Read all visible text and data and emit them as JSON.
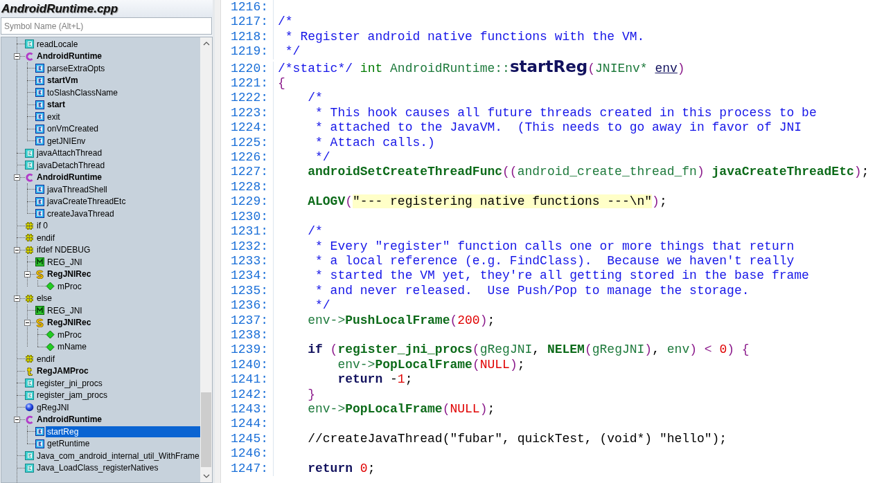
{
  "file_title": "AndroidRuntime.cpp",
  "symbol_search": {
    "placeholder": "Symbol Name (Alt+L)"
  },
  "symbol_tree": [
    {
      "label": "readLocale",
      "kind": "function",
      "bold": false,
      "selected": false
    },
    {
      "label": "AndroidRuntime",
      "kind": "class",
      "bold": true,
      "selected": false,
      "expanded": true,
      "children": [
        {
          "label": "parseExtraOpts",
          "kind": "method",
          "bold": false,
          "selected": false
        },
        {
          "label": "startVm",
          "kind": "method",
          "bold": true,
          "selected": false
        },
        {
          "label": "toSlashClassName",
          "kind": "method",
          "bold": false,
          "selected": false
        },
        {
          "label": "start",
          "kind": "method",
          "bold": true,
          "selected": false
        },
        {
          "label": "exit",
          "kind": "method",
          "bold": false,
          "selected": false
        },
        {
          "label": "onVmCreated",
          "kind": "method",
          "bold": false,
          "selected": false
        },
        {
          "label": "getJNIEnv",
          "kind": "method",
          "bold": false,
          "selected": false
        }
      ]
    },
    {
      "label": "javaAttachThread",
      "kind": "function",
      "bold": false,
      "selected": false
    },
    {
      "label": "javaDetachThread",
      "kind": "function",
      "bold": false,
      "selected": false
    },
    {
      "label": "AndroidRuntime",
      "kind": "class",
      "bold": true,
      "selected": false,
      "expanded": true,
      "children": [
        {
          "label": "javaThreadShell",
          "kind": "method",
          "bold": false,
          "selected": false
        },
        {
          "label": "javaCreateThreadEtc",
          "kind": "method",
          "bold": false,
          "selected": false
        },
        {
          "label": "createJavaThread",
          "kind": "method",
          "bold": false,
          "selected": false
        }
      ]
    },
    {
      "label": "if 0",
      "kind": "preprocessor",
      "bold": false,
      "selected": false
    },
    {
      "label": "endif",
      "kind": "preprocessor",
      "bold": false,
      "selected": false
    },
    {
      "label": "ifdef NDEBUG",
      "kind": "preprocessor",
      "bold": false,
      "selected": false,
      "expanded": true,
      "children": [
        {
          "label": "REG_JNI",
          "kind": "macro",
          "bold": false,
          "selected": false
        },
        {
          "label": "RegJNIRec",
          "kind": "struct",
          "bold": true,
          "selected": false,
          "expanded": true,
          "children": [
            {
              "label": "mProc",
              "kind": "member",
              "bold": false,
              "selected": false
            }
          ]
        }
      ]
    },
    {
      "label": "else",
      "kind": "preprocessor",
      "bold": false,
      "selected": false,
      "expanded": true,
      "children": [
        {
          "label": "REG_JNI",
          "kind": "macro",
          "bold": false,
          "selected": false
        },
        {
          "label": "RegJNIRec",
          "kind": "struct",
          "bold": true,
          "selected": false,
          "expanded": true,
          "children": [
            {
              "label": "mProc",
              "kind": "member",
              "bold": false,
              "selected": false
            },
            {
              "label": "mName",
              "kind": "member",
              "bold": false,
              "selected": false
            }
          ]
        }
      ]
    },
    {
      "label": "endif",
      "kind": "preprocessor",
      "bold": false,
      "selected": false
    },
    {
      "label": "RegJAMProc",
      "kind": "typedef",
      "bold": true,
      "selected": false
    },
    {
      "label": "register_jni_procs",
      "kind": "function",
      "bold": false,
      "selected": false
    },
    {
      "label": "register_jam_procs",
      "kind": "function",
      "bold": false,
      "selected": false
    },
    {
      "label": "gRegJNI",
      "kind": "variable",
      "bold": false,
      "selected": false
    },
    {
      "label": "AndroidRuntime",
      "kind": "class",
      "bold": true,
      "selected": false,
      "expanded": true,
      "children": [
        {
          "label": "startReg",
          "kind": "method",
          "bold": false,
          "selected": true
        },
        {
          "label": "getRuntime",
          "kind": "method",
          "bold": false,
          "selected": false
        }
      ]
    },
    {
      "label": "Java_com_android_internal_util_WithFrame",
      "kind": "function",
      "bold": false,
      "selected": false
    },
    {
      "label": "Java_LoadClass_registerNatives",
      "kind": "function",
      "bold": false,
      "selected": false
    }
  ],
  "code_lines": [
    {
      "number": "1216:"
    },
    {
      "number": "1217:",
      "tokens": [
        {
          "kind": "comment",
          "text": "/*"
        }
      ]
    },
    {
      "number": "1218:",
      "tokens": [
        {
          "kind": "comment",
          "text": " * Register android native functions with the VM."
        }
      ]
    },
    {
      "number": "1219:",
      "tokens": [
        {
          "kind": "comment",
          "text": " */"
        }
      ]
    },
    {
      "number": "1220:",
      "tokens": [
        {
          "kind": "comment",
          "text": "/*static*/"
        },
        {
          "kind": "keyword",
          "text": " int"
        },
        {
          "kind": "type",
          "text": " AndroidRuntime::"
        },
        {
          "kind": "declaration",
          "text": "startReg"
        },
        {
          "kind": "paren",
          "text": "("
        },
        {
          "kind": "type",
          "text": "JNIEnv* "
        },
        {
          "kind": "parameter",
          "text": "env"
        },
        {
          "kind": "paren",
          "text": ")"
        }
      ]
    },
    {
      "number": "1221:",
      "tokens": [
        {
          "kind": "paren",
          "text": "{"
        }
      ]
    },
    {
      "number": "1222:",
      "tokens": [
        {
          "kind": "comment",
          "text": "    /*"
        }
      ]
    },
    {
      "number": "1223:",
      "tokens": [
        {
          "kind": "comment",
          "text": "     * This hook causes all future threads created in this process to be"
        }
      ]
    },
    {
      "number": "1224:",
      "tokens": [
        {
          "kind": "comment",
          "text": "     * attached to the JavaVM.  (This needs to go away in favor of JNI"
        }
      ]
    },
    {
      "number": "1225:",
      "tokens": [
        {
          "kind": "comment",
          "text": "     * Attach calls.)"
        }
      ]
    },
    {
      "number": "1226:",
      "tokens": [
        {
          "kind": "comment",
          "text": "     */"
        }
      ]
    },
    {
      "number": "1227:",
      "tokens": [
        {
          "kind": "function",
          "text": "    androidSetCreateThreadFunc"
        },
        {
          "kind": "paren",
          "text": "(("
        },
        {
          "kind": "type",
          "text": "android_create_thread_fn"
        },
        {
          "kind": "paren",
          "text": ")"
        },
        {
          "kind": "function",
          "text": " javaCreateThreadEtc"
        },
        {
          "kind": "paren",
          "text": ")"
        },
        {
          "kind": "plain",
          "text": ";"
        }
      ]
    },
    {
      "number": "1228:"
    },
    {
      "number": "1229:",
      "tokens": [
        {
          "kind": "function",
          "text": "    ALOGV"
        },
        {
          "kind": "paren",
          "text": "("
        },
        {
          "kind": "string",
          "text": "\"--- registering native functions ---\\n\""
        },
        {
          "kind": "paren",
          "text": ")"
        },
        {
          "kind": "plain",
          "text": ";"
        }
      ]
    },
    {
      "number": "1230:"
    },
    {
      "number": "1231:",
      "tokens": [
        {
          "kind": "comment",
          "text": "    /*"
        }
      ]
    },
    {
      "number": "1232:",
      "tokens": [
        {
          "kind": "comment",
          "text": "     * Every \"register\" function calls one or more things that return"
        }
      ]
    },
    {
      "number": "1233:",
      "tokens": [
        {
          "kind": "comment",
          "text": "     * a local reference (e.g. FindClass).  Because we haven't really"
        }
      ]
    },
    {
      "number": "1234:",
      "tokens": [
        {
          "kind": "comment",
          "text": "     * started the VM yet, they're all getting stored in the base frame"
        }
      ]
    },
    {
      "number": "1235:",
      "tokens": [
        {
          "kind": "comment",
          "text": "     * and never released.  Use Push/Pop to manage the storage."
        }
      ]
    },
    {
      "number": "1236:",
      "tokens": [
        {
          "kind": "comment",
          "text": "     */"
        }
      ]
    },
    {
      "number": "1237:",
      "tokens": [
        {
          "kind": "type",
          "text": "    env->"
        },
        {
          "kind": "function",
          "text": "PushLocalFrame"
        },
        {
          "kind": "paren",
          "text": "("
        },
        {
          "kind": "number",
          "text": "200"
        },
        {
          "kind": "paren",
          "text": ")"
        },
        {
          "kind": "plain",
          "text": ";"
        }
      ]
    },
    {
      "number": "1238:"
    },
    {
      "number": "1239:",
      "tokens": [
        {
          "kind": "control",
          "text": "    if"
        },
        {
          "kind": "paren",
          "text": " ("
        },
        {
          "kind": "function",
          "text": "register_jni_procs"
        },
        {
          "kind": "paren",
          "text": "("
        },
        {
          "kind": "type",
          "text": "gRegJNI"
        },
        {
          "kind": "plain",
          "text": ", "
        },
        {
          "kind": "function",
          "text": "NELEM"
        },
        {
          "kind": "paren",
          "text": "("
        },
        {
          "kind": "type",
          "text": "gRegJNI"
        },
        {
          "kind": "paren",
          "text": ")"
        },
        {
          "kind": "plain",
          "text": ", "
        },
        {
          "kind": "type",
          "text": "env"
        },
        {
          "kind": "paren",
          "text": ")"
        },
        {
          "kind": "paren",
          "text": " <"
        },
        {
          "kind": "number",
          "text": " 0"
        },
        {
          "kind": "paren",
          "text": ")"
        },
        {
          "kind": "paren",
          "text": " {"
        }
      ]
    },
    {
      "number": "1240:",
      "tokens": [
        {
          "kind": "type",
          "text": "        env->"
        },
        {
          "kind": "function",
          "text": "PopLocalFrame"
        },
        {
          "kind": "paren",
          "text": "("
        },
        {
          "kind": "number",
          "text": "NULL"
        },
        {
          "kind": "paren",
          "text": ")"
        },
        {
          "kind": "plain",
          "text": ";"
        }
      ]
    },
    {
      "number": "1241:",
      "tokens": [
        {
          "kind": "control",
          "text": "        return"
        },
        {
          "kind": "plain",
          "text": " -"
        },
        {
          "kind": "number",
          "text": "1"
        },
        {
          "kind": "plain",
          "text": ";"
        }
      ]
    },
    {
      "number": "1242:",
      "tokens": [
        {
          "kind": "paren",
          "text": "    }"
        }
      ]
    },
    {
      "number": "1243:",
      "tokens": [
        {
          "kind": "type",
          "text": "    env->"
        },
        {
          "kind": "function",
          "text": "PopLocalFrame"
        },
        {
          "kind": "paren",
          "text": "("
        },
        {
          "kind": "number",
          "text": "NULL"
        },
        {
          "kind": "paren",
          "text": ")"
        },
        {
          "kind": "plain",
          "text": ";"
        }
      ]
    },
    {
      "number": "1244:"
    },
    {
      "number": "1245:",
      "tokens": [
        {
          "kind": "plain",
          "text": "    //createJavaThread(\"fubar\", quickTest, (void*) \"hello\");"
        }
      ]
    },
    {
      "number": "1246:"
    },
    {
      "number": "1247:",
      "tokens": [
        {
          "kind": "control",
          "text": "    return"
        },
        {
          "kind": "number",
          "text": " 0"
        },
        {
          "kind": "plain",
          "text": ";"
        }
      ]
    }
  ]
}
